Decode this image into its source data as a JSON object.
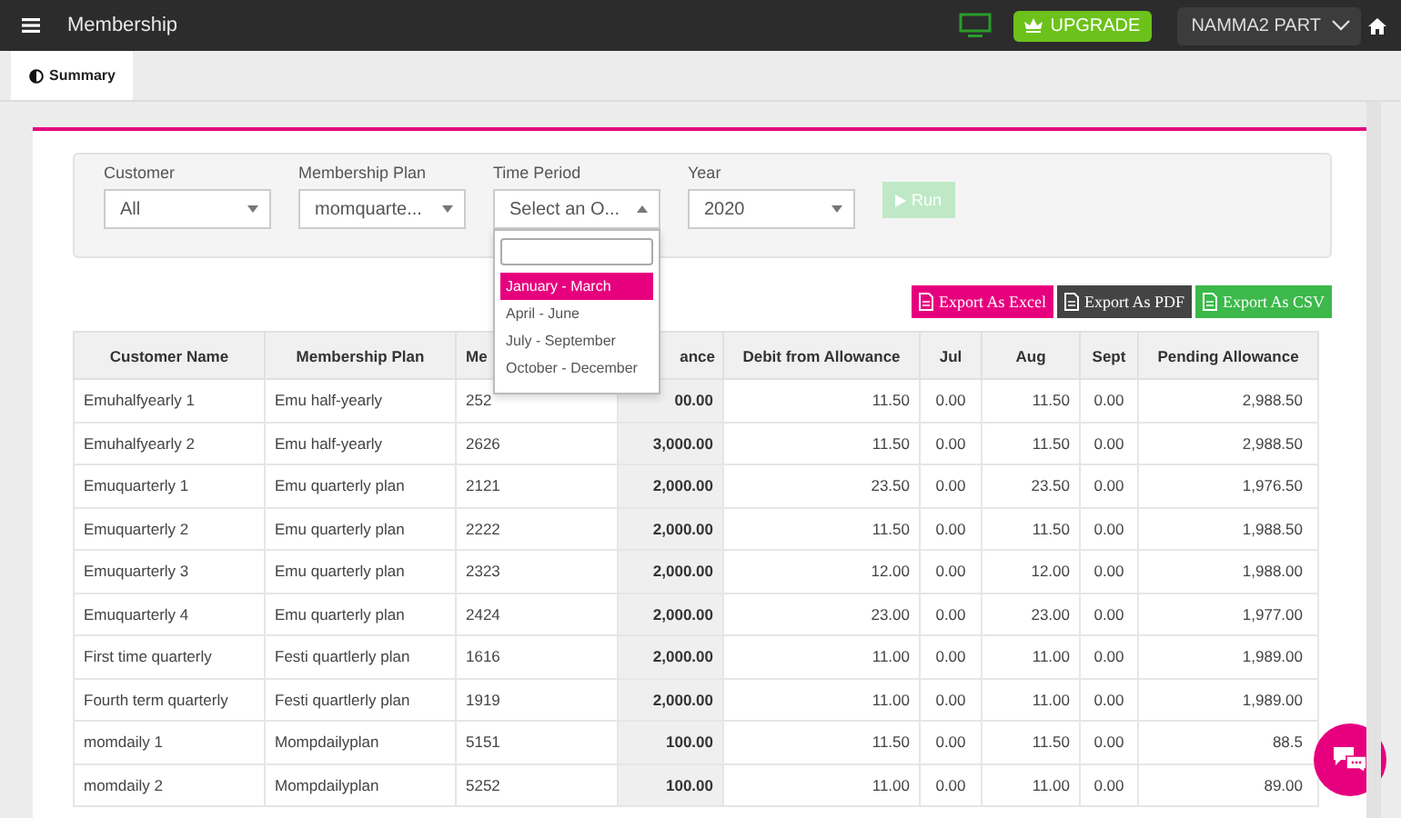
{
  "topbar": {
    "title": "Membership",
    "upgrade": "UPGRADE",
    "user": "NAMMA2 PART"
  },
  "tabs": [
    {
      "label": "Summary",
      "selected": true
    }
  ],
  "filters": [
    {
      "label": "Customer",
      "value": "All",
      "expanded": false
    },
    {
      "label": "Membership Plan",
      "value": "momquarte...",
      "expanded": false
    },
    {
      "label": "Time Period",
      "value": "Select an O...",
      "expanded": true
    },
    {
      "label": "Year",
      "value": "2020",
      "expanded": false
    }
  ],
  "run_button": {
    "label": "Run",
    "disabled": true
  },
  "time_period_options": [
    {
      "label": "January - March",
      "selected": true
    },
    {
      "label": "April - June",
      "selected": false
    },
    {
      "label": "July - September",
      "selected": false
    },
    {
      "label": "October - December",
      "selected": false
    }
  ],
  "exports": [
    {
      "label": "Export As Excel",
      "kind": "excel"
    },
    {
      "label": "Export As PDF",
      "kind": "pdf"
    },
    {
      "label": "Export As CSV",
      "kind": "csv"
    }
  ],
  "table": {
    "columns": [
      "Customer Name",
      "Membership Plan",
      "Me",
      "ance",
      "Debit from Allowance",
      "Jul",
      "Aug",
      "Sept",
      "Pending Allowance"
    ],
    "rows": [
      [
        "Emuhalfyearly 1",
        "Emu half-yearly",
        "252",
        "00.00",
        "11.50",
        "0.00",
        "11.50",
        "0.00",
        "2,988.50"
      ],
      [
        "Emuhalfyearly 2",
        "Emu half-yearly",
        "2626",
        "3,000.00",
        "11.50",
        "0.00",
        "11.50",
        "0.00",
        "2,988.50"
      ],
      [
        "Emuquarterly 1",
        "Emu quarterly plan",
        "2121",
        "2,000.00",
        "23.50",
        "0.00",
        "23.50",
        "0.00",
        "1,976.50"
      ],
      [
        "Emuquarterly 2",
        "Emu quarterly plan",
        "2222",
        "2,000.00",
        "11.50",
        "0.00",
        "11.50",
        "0.00",
        "1,988.50"
      ],
      [
        "Emuquarterly 3",
        "Emu quarterly plan",
        "2323",
        "2,000.00",
        "12.00",
        "0.00",
        "12.00",
        "0.00",
        "1,988.00"
      ],
      [
        "Emuquarterly 4",
        "Emu quarterly plan",
        "2424",
        "2,000.00",
        "23.00",
        "0.00",
        "23.00",
        "0.00",
        "1,977.00"
      ],
      [
        "First time quarterly",
        "Festi quartlerly plan",
        "1616",
        "2,000.00",
        "11.00",
        "0.00",
        "11.00",
        "0.00",
        "1,989.00"
      ],
      [
        "Fourth term quarterly",
        "Festi quartlerly plan",
        "1919",
        "2,000.00",
        "11.00",
        "0.00",
        "11.00",
        "0.00",
        "1,989.00"
      ],
      [
        "momdaily 1",
        "Mompdailyplan",
        "5151",
        "100.00",
        "11.50",
        "0.00",
        "11.50",
        "0.00",
        "88.5"
      ],
      [
        "momdaily 2",
        "Mompdailyplan",
        "5252",
        "100.00",
        "11.00",
        "0.00",
        "11.00",
        "0.00",
        "89.00"
      ]
    ]
  }
}
